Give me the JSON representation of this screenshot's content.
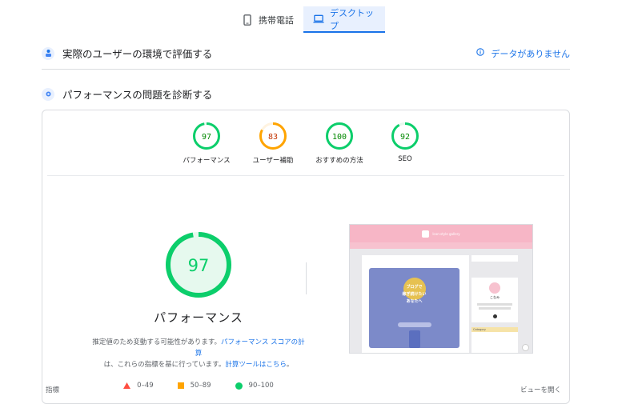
{
  "tabs": [
    {
      "label": "携帯電話",
      "icon": "phone-icon",
      "active": false
    },
    {
      "label": "デスクトップ",
      "icon": "laptop-icon",
      "active": true
    }
  ],
  "field_data": {
    "title": "実際のユーザーの環境で評価する",
    "no_data": "データがありません"
  },
  "diagnose": {
    "title": "パフォーマンスの問題を診断する"
  },
  "scores": [
    {
      "value": "97",
      "label": "パフォーマンス",
      "color": "#0cce6b",
      "fill": 0.97
    },
    {
      "value": "83",
      "label": "ユーザー補助",
      "color": "#ffa400",
      "fill": 0.83
    },
    {
      "value": "100",
      "label": "おすすめの方法",
      "color": "#0cce6b",
      "fill": 1.0
    },
    {
      "value": "92",
      "label": "SEO",
      "color": "#0cce6b",
      "fill": 0.92
    }
  ],
  "main_score": {
    "value": "97",
    "title": "パフォーマンス",
    "desc_prefix": "推定値のため変動する可能性があります。",
    "desc_link1": "パフォーマンス スコアの計算",
    "desc_mid": "は、これらの指標を基に行っています。",
    "desc_link2": "計算ツールはこちら",
    "desc_suffix": "。"
  },
  "legend": {
    "fail": "0–49",
    "average": "50–89",
    "pass": "90–100"
  },
  "screenshot": {
    "header_text": "Icon-style gallery",
    "hero_lines": [
      "ブログで",
      "稼ぎ続けたい",
      "あなたへ"
    ],
    "profile_name": "こなみ",
    "category": "Category"
  },
  "footer": {
    "left": "指標",
    "right": "ビューを開く"
  },
  "colors": {
    "accent": "#1a73e8",
    "pass": "#0cce6b",
    "average": "#ffa400",
    "fail": "#ff4e42"
  }
}
